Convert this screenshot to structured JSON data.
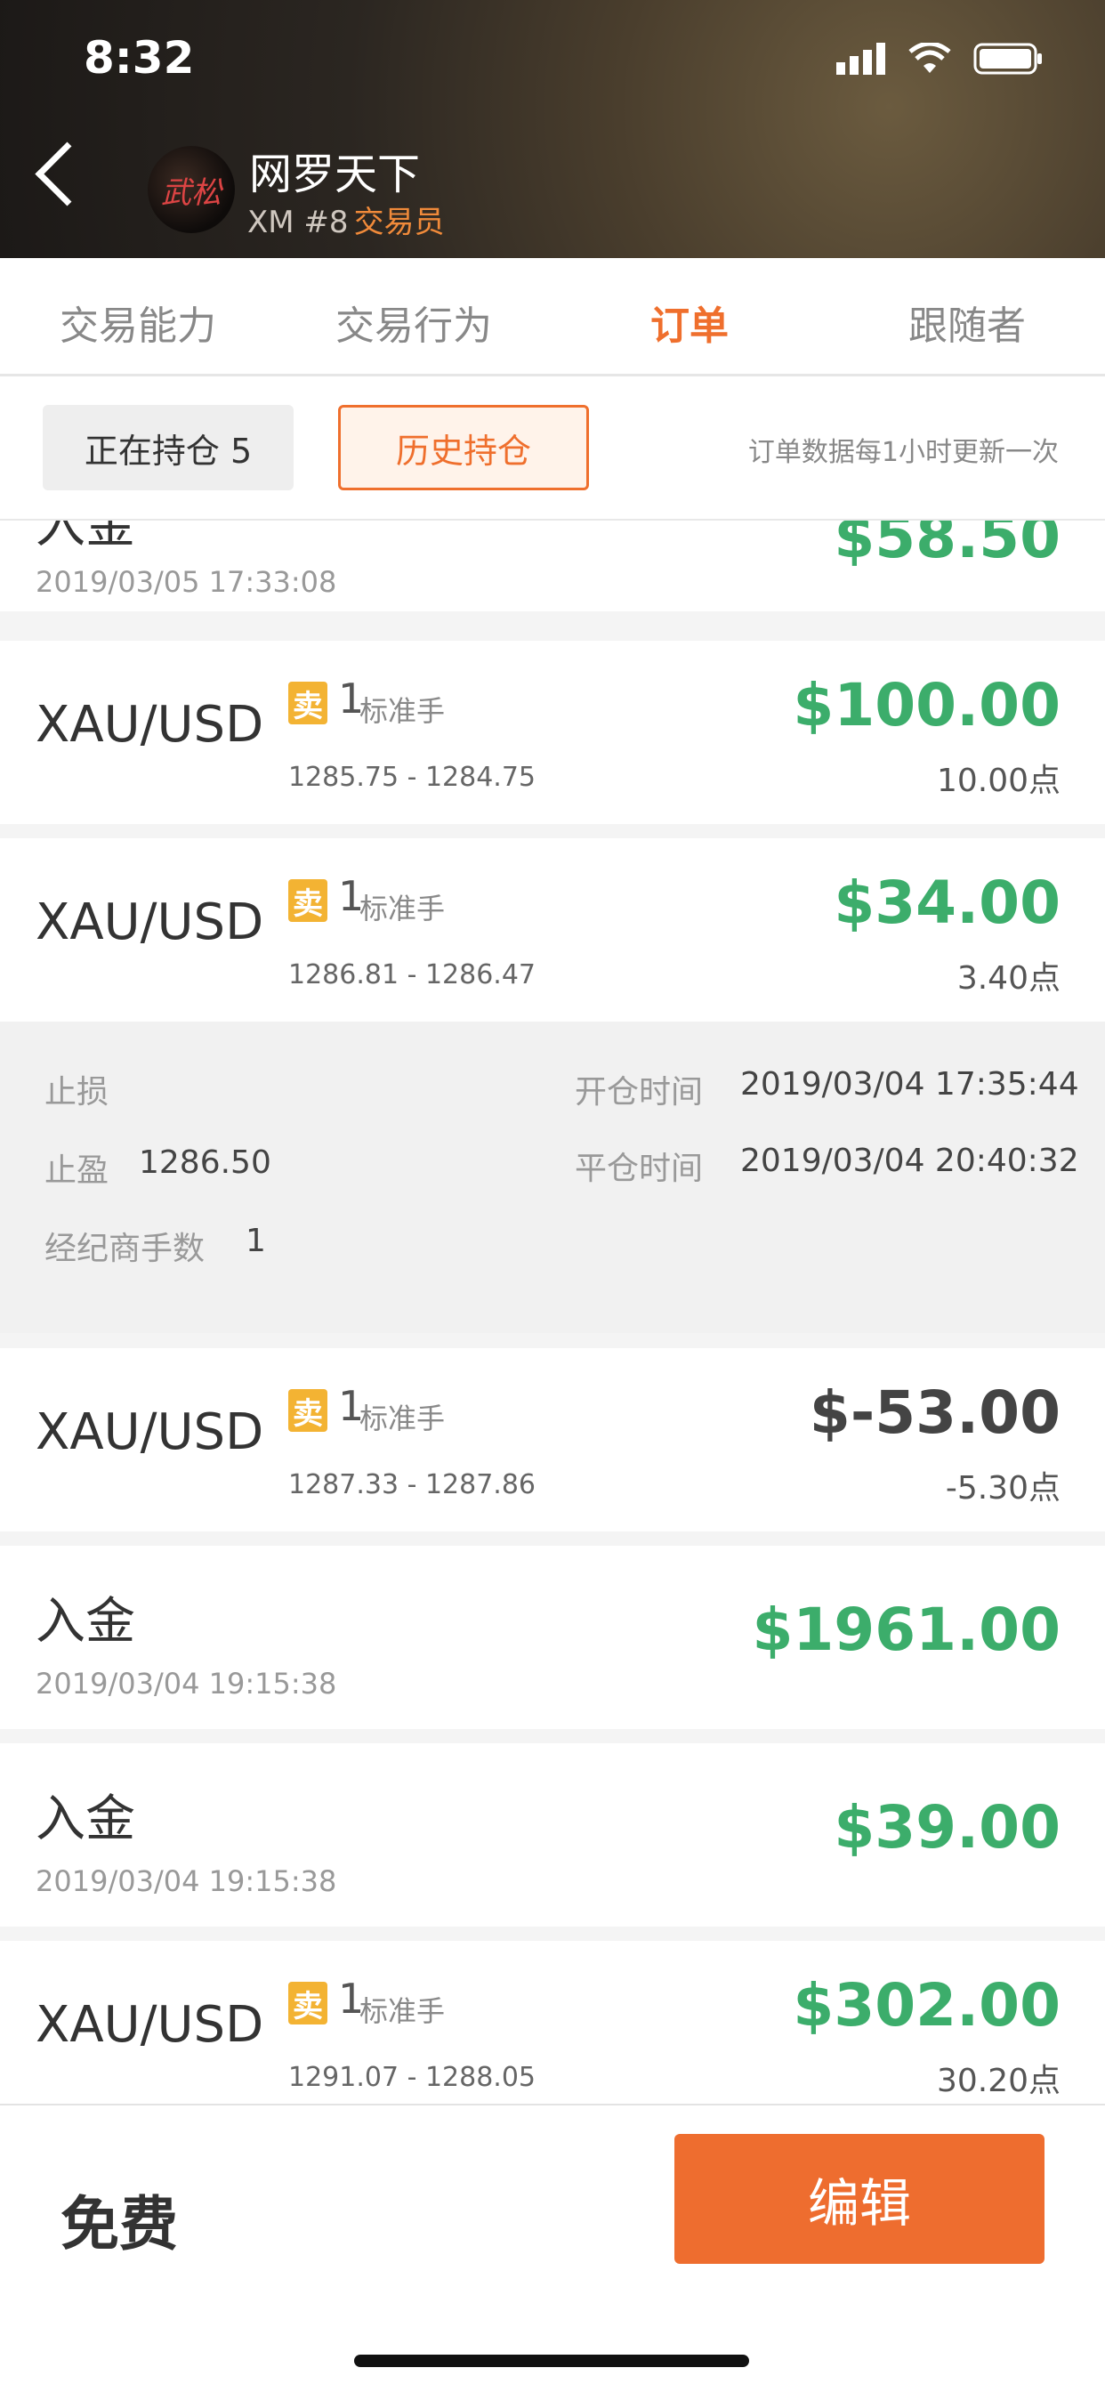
{
  "status_bar": {
    "time": "8:32"
  },
  "header": {
    "title": "网罗天下",
    "broker": "XM #8",
    "role": "交易员",
    "avatar_text": "武松"
  },
  "tabs": [
    {
      "label": "交易能力"
    },
    {
      "label": "交易行为"
    },
    {
      "label": "订单"
    },
    {
      "label": "跟随者"
    }
  ],
  "filters": {
    "open_positions": "正在持仓 5",
    "history_positions": "历史持仓",
    "note": "订单数据每1小时更新一次"
  },
  "orders": [
    {
      "type": "deposit",
      "title": "入金",
      "date": "2019/03/05 17:33:08",
      "amount": "$58.50"
    },
    {
      "type": "trade",
      "symbol": "XAU/USD",
      "side": "卖",
      "lots": "1",
      "unit": "标准手",
      "range": "1285.75 - 1284.75",
      "amount": "$100.00",
      "points": "10.00点"
    },
    {
      "type": "trade",
      "symbol": "XAU/USD",
      "side": "卖",
      "lots": "1",
      "unit": "标准手",
      "range": "1286.81 - 1286.47",
      "amount": "$34.00",
      "points": "3.40点"
    },
    {
      "type": "trade",
      "symbol": "XAU/USD",
      "side": "卖",
      "lots": "1",
      "unit": "标准手",
      "range": "1287.33 - 1287.86",
      "amount": "$-53.00",
      "points": "-5.30点"
    },
    {
      "type": "deposit",
      "title": "入金",
      "date": "2019/03/04 19:15:38",
      "amount": "$1961.00"
    },
    {
      "type": "deposit",
      "title": "入金",
      "date": "2019/03/04 19:15:38",
      "amount": "$39.00"
    },
    {
      "type": "trade",
      "symbol": "XAU/USD",
      "side": "卖",
      "lots": "1",
      "unit": "标准手",
      "range": "1291.07 - 1288.05",
      "amount": "$302.00",
      "points": "30.20点"
    }
  ],
  "detail": {
    "stop_loss_label": "止损",
    "take_profit_label": "止盈",
    "take_profit_value": "1286.50",
    "broker_lots_label": "经纪商手数",
    "broker_lots_value": "1",
    "open_time_label": "开仓时间",
    "open_time_value": "2019/03/04 17:35:44",
    "close_time_label": "平仓时间",
    "close_time_value": "2019/03/04 20:40:32"
  },
  "bottom": {
    "price_label": "免费",
    "edit_label": "编辑"
  },
  "colors": {
    "accent": "#ef6f2d",
    "profit": "#3cad6b",
    "sell_badge": "#f3b333"
  }
}
